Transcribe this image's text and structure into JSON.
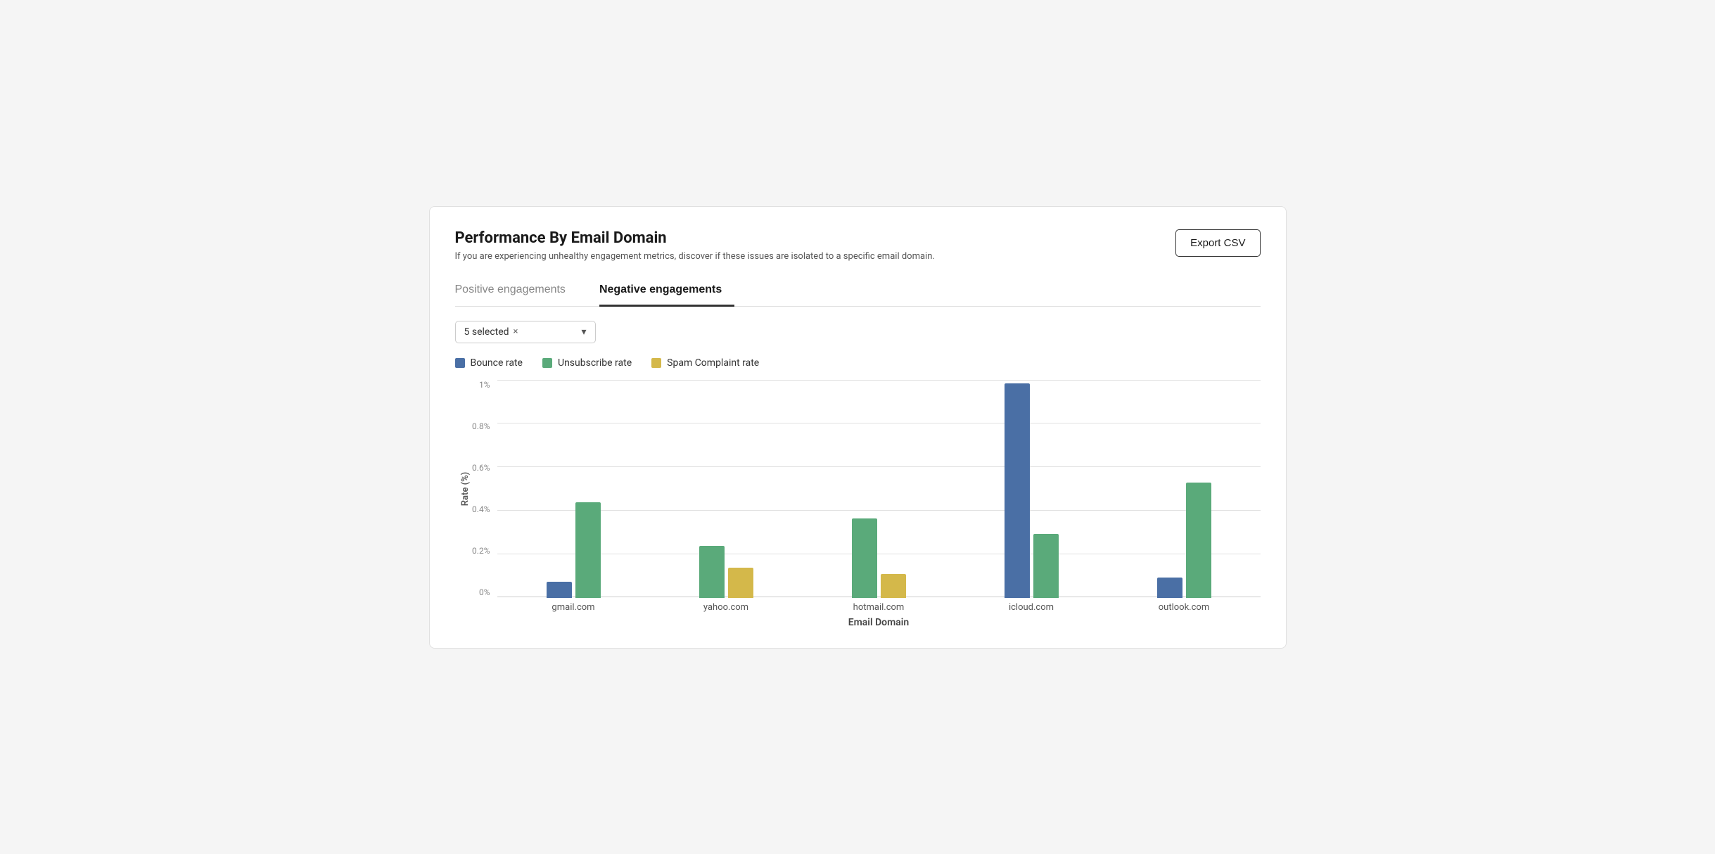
{
  "card": {
    "title": "Performance By Email Domain",
    "subtitle": "If you are experiencing unhealthy engagement metrics, discover if these issues are isolated to a specific email domain."
  },
  "export_button": "Export CSV",
  "tabs": [
    {
      "label": "Positive engagements",
      "active": false
    },
    {
      "label": "Negative engagements",
      "active": true
    }
  ],
  "filter": {
    "label": "5 selected",
    "close_icon": "×",
    "chevron": "▾"
  },
  "legend": [
    {
      "label": "Bounce rate",
      "color": "#4a6fa5"
    },
    {
      "label": "Unsubscribe rate",
      "color": "#5aaa7a"
    },
    {
      "label": "Spam Complaint rate",
      "color": "#d4b84a"
    }
  ],
  "y_axis": {
    "label": "Rate (%)",
    "ticks": [
      "1%",
      "0.8%",
      "0.6%",
      "0.4%",
      "0.2%",
      "0%"
    ]
  },
  "x_axis": {
    "title": "Email Domain",
    "labels": [
      "gmail.com",
      "yahoo.com",
      "hotmail.com",
      "icloud.com",
      "outlook.com"
    ]
  },
  "chart": {
    "max_value": 1.1,
    "domains": [
      {
        "name": "gmail.com",
        "bars": [
          {
            "type": "bounce",
            "value": 0.08,
            "color": "#4a6fa5"
          },
          {
            "type": "unsubscribe",
            "value": 0.48,
            "color": "#5aaa7a"
          },
          {
            "type": "spam",
            "value": 0,
            "color": "#d4b84a"
          }
        ]
      },
      {
        "name": "yahoo.com",
        "bars": [
          {
            "type": "bounce",
            "value": 0,
            "color": "#4a6fa5"
          },
          {
            "type": "unsubscribe",
            "value": 0.26,
            "color": "#5aaa7a"
          },
          {
            "type": "spam",
            "value": 0.15,
            "color": "#d4b84a"
          }
        ]
      },
      {
        "name": "hotmail.com",
        "bars": [
          {
            "type": "bounce",
            "value": 0,
            "color": "#4a6fa5"
          },
          {
            "type": "unsubscribe",
            "value": 0.4,
            "color": "#5aaa7a"
          },
          {
            "type": "spam",
            "value": 0.12,
            "color": "#d4b84a"
          }
        ]
      },
      {
        "name": "icloud.com",
        "bars": [
          {
            "type": "bounce",
            "value": 1.08,
            "color": "#4a6fa5"
          },
          {
            "type": "unsubscribe",
            "value": 0.32,
            "color": "#5aaa7a"
          },
          {
            "type": "spam",
            "value": 0,
            "color": "#d4b84a"
          }
        ]
      },
      {
        "name": "outlook.com",
        "bars": [
          {
            "type": "bounce",
            "value": 0.1,
            "color": "#4a6fa5"
          },
          {
            "type": "unsubscribe",
            "value": 0.58,
            "color": "#5aaa7a"
          },
          {
            "type": "spam",
            "value": 0,
            "color": "#d4b84a"
          }
        ]
      }
    ]
  }
}
